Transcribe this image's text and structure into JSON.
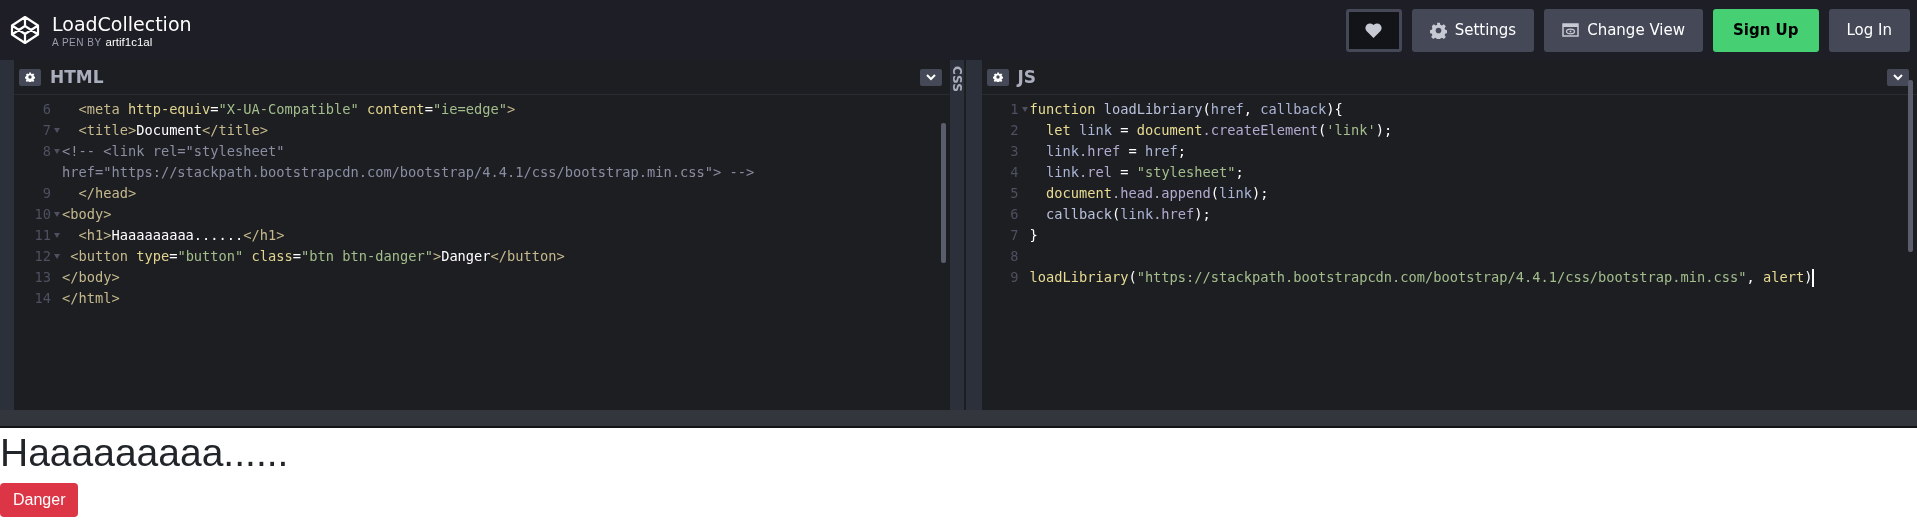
{
  "header": {
    "title": "LoadCollection",
    "byline_prefix": "A PEN BY",
    "author": "artif1c1al",
    "buttons": [
      {
        "kind": "heart"
      },
      {
        "kind": "settings",
        "label": "Settings"
      },
      {
        "kind": "view",
        "label": "Change View"
      },
      {
        "kind": "signup",
        "label": "Sign Up"
      },
      {
        "kind": "login",
        "label": "Log In"
      }
    ]
  },
  "panels": [
    {
      "kind": "editor",
      "title": "HTML",
      "lines": [
        {
          "number": "6",
          "fold": false,
          "rows": [
            [
              {
                "kind": "tag",
                "text": "  <meta"
              },
              {
                "kind": "attr",
                "text": " http-equiv"
              },
              {
                "kind": "plain",
                "text": "="
              },
              {
                "kind": "str",
                "text": "\"X-UA-Compatible\""
              },
              {
                "kind": "attr",
                "text": " content"
              },
              {
                "kind": "plain",
                "text": "="
              },
              {
                "kind": "str",
                "text": "\"ie=edge\""
              },
              {
                "kind": "tag",
                "text": ">"
              }
            ]
          ]
        },
        {
          "number": "7",
          "fold": true,
          "rows": [
            [
              {
                "kind": "tag",
                "text": "  <title>"
              },
              {
                "kind": "plain",
                "text": "Document"
              },
              {
                "kind": "tag",
                "text": "</title>"
              }
            ]
          ]
        },
        {
          "number": "8",
          "fold": true,
          "rows": [
            [
              {
                "kind": "comment",
                "text": "<!-- <link rel=\"stylesheet\""
              }
            ],
            [
              {
                "kind": "comment",
                "text": "href=\"https://stackpath.bootstrapcdn.com/bootstrap/4.4.1/css/bootstrap.min.css\"> -->"
              }
            ]
          ]
        },
        {
          "number": "9",
          "fold": false,
          "rows": [
            [
              {
                "kind": "tag",
                "text": "  </head>"
              }
            ]
          ]
        },
        {
          "number": "10",
          "fold": true,
          "rows": [
            [
              {
                "kind": "tag",
                "text": "<body>"
              }
            ]
          ]
        },
        {
          "number": "11",
          "fold": true,
          "rows": [
            [
              {
                "kind": "tag",
                "text": "  <h1>"
              },
              {
                "kind": "plain",
                "text": "Haaaaaaaaa......"
              },
              {
                "kind": "tag",
                "text": "</h1>"
              }
            ]
          ]
        },
        {
          "number": "12",
          "fold": true,
          "rows": [
            [
              {
                "kind": "tag",
                "text": " <button"
              },
              {
                "kind": "attr",
                "text": " type"
              },
              {
                "kind": "plain",
                "text": "="
              },
              {
                "kind": "str",
                "text": "\"button\""
              },
              {
                "kind": "attr",
                "text": " class"
              },
              {
                "kind": "plain",
                "text": "="
              },
              {
                "kind": "str",
                "text": "\"btn btn-danger\""
              },
              {
                "kind": "tag",
                "text": ">"
              },
              {
                "kind": "plain",
                "text": "Danger"
              },
              {
                "kind": "tag",
                "text": "</button>"
              }
            ]
          ]
        },
        {
          "number": "13",
          "fold": false,
          "rows": [
            [
              {
                "kind": "tag",
                "text": "</body>"
              }
            ]
          ]
        },
        {
          "number": "14",
          "fold": false,
          "rows": [
            [
              {
                "kind": "tag",
                "text": "</html>"
              }
            ]
          ]
        }
      ]
    },
    {
      "kind": "collapsed",
      "title": "CSS"
    },
    {
      "kind": "editor",
      "title": "JS",
      "lines": [
        {
          "number": "1",
          "fold": true,
          "rows": [
            [
              {
                "kind": "kw",
                "text": "function"
              },
              {
                "kind": "fn",
                "text": " loadLibriary"
              },
              {
                "kind": "plain",
                "text": "("
              },
              {
                "kind": "var",
                "text": "href"
              },
              {
                "kind": "plain",
                "text": ", "
              },
              {
                "kind": "var",
                "text": "callback"
              },
              {
                "kind": "plain",
                "text": "){"
              }
            ]
          ]
        },
        {
          "number": "2",
          "fold": false,
          "rows": [
            [
              {
                "kind": "kw",
                "text": "  let"
              },
              {
                "kind": "var",
                "text": " link"
              },
              {
                "kind": "plain",
                "text": " = "
              },
              {
                "kind": "kw",
                "text": "document"
              },
              {
                "kind": "prop",
                "text": ".createElement"
              },
              {
                "kind": "plain",
                "text": "("
              },
              {
                "kind": "str",
                "text": "'link'"
              },
              {
                "kind": "plain",
                "text": ");"
              }
            ]
          ]
        },
        {
          "number": "3",
          "fold": false,
          "rows": [
            [
              {
                "kind": "var",
                "text": "  link"
              },
              {
                "kind": "prop",
                "text": ".href"
              },
              {
                "kind": "plain",
                "text": " = "
              },
              {
                "kind": "var",
                "text": "href"
              },
              {
                "kind": "plain",
                "text": ";"
              }
            ]
          ]
        },
        {
          "number": "4",
          "fold": false,
          "rows": [
            [
              {
                "kind": "var",
                "text": "  link"
              },
              {
                "kind": "prop",
                "text": ".rel"
              },
              {
                "kind": "plain",
                "text": " = "
              },
              {
                "kind": "str",
                "text": "\"stylesheet\""
              },
              {
                "kind": "plain",
                "text": ";"
              }
            ]
          ]
        },
        {
          "number": "5",
          "fold": false,
          "rows": [
            [
              {
                "kind": "kw",
                "text": "  document"
              },
              {
                "kind": "prop",
                "text": ".head"
              },
              {
                "kind": "prop",
                "text": ".append"
              },
              {
                "kind": "plain",
                "text": "("
              },
              {
                "kind": "var",
                "text": "link"
              },
              {
                "kind": "plain",
                "text": ");"
              }
            ]
          ]
        },
        {
          "number": "6",
          "fold": false,
          "rows": [
            [
              {
                "kind": "fn",
                "text": "  callback"
              },
              {
                "kind": "plain",
                "text": "("
              },
              {
                "kind": "var",
                "text": "link"
              },
              {
                "kind": "prop",
                "text": ".href"
              },
              {
                "kind": "plain",
                "text": ");"
              }
            ]
          ]
        },
        {
          "number": "7",
          "fold": false,
          "rows": [
            [
              {
                "kind": "plain",
                "text": "}"
              }
            ]
          ]
        },
        {
          "number": "8",
          "fold": false
        },
        {
          "number": "9",
          "fold": false,
          "cursor": true,
          "rows": [
            [
              {
                "kind": "kw",
                "text": "loadLibriary"
              },
              {
                "kind": "plain",
                "text": "("
              },
              {
                "kind": "str",
                "text": "\"https://stackpath.bootstrapcdn.com/bootstrap/4.4.1/css/bootstrap.min.css\""
              },
              {
                "kind": "plain",
                "text": ", "
              },
              {
                "kind": "kw",
                "text": "alert"
              },
              {
                "kind": "plain",
                "text": ")"
              }
            ]
          ]
        }
      ]
    }
  ],
  "preview": {
    "heading": "Haaaaaaaaa......",
    "button": "Danger"
  }
}
